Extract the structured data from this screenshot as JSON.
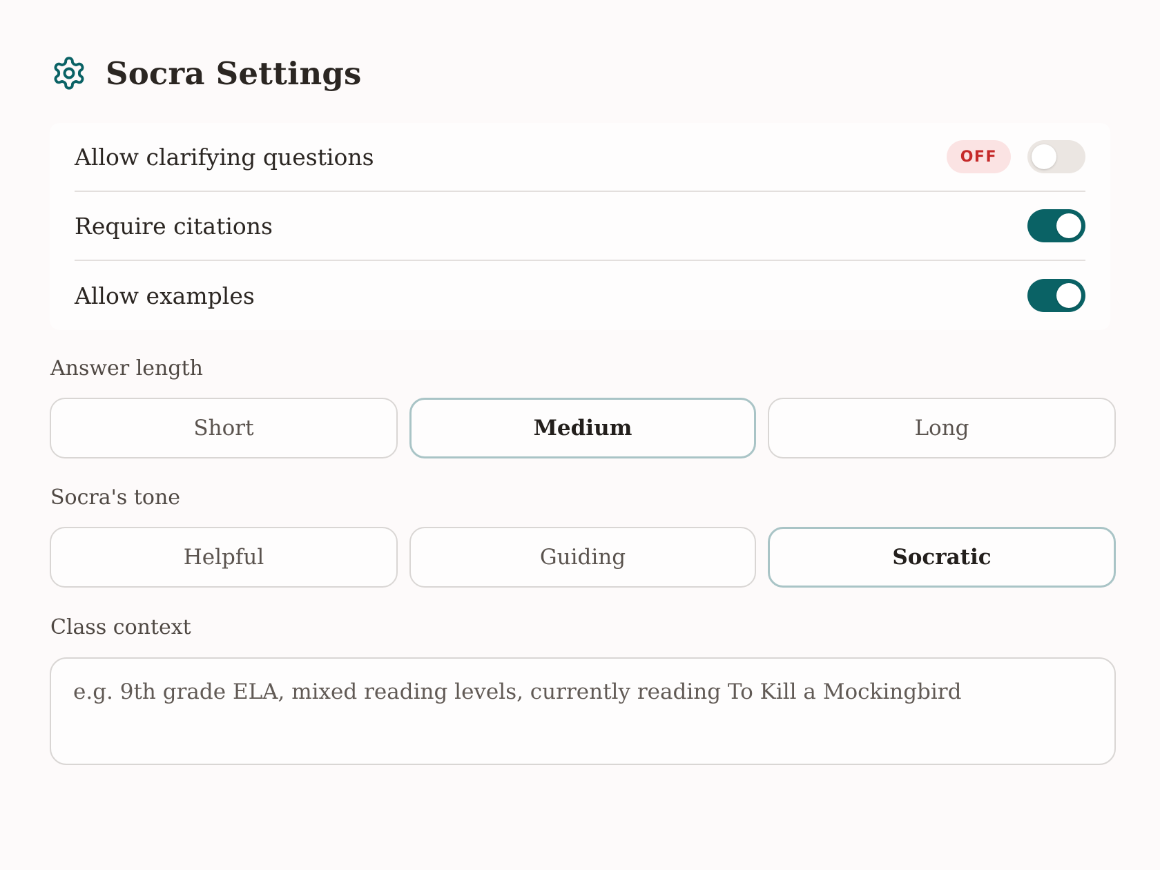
{
  "header": {
    "icon": "gear-icon",
    "title": "Socra Settings",
    "accent_color": "#0a6265"
  },
  "toggles": [
    {
      "label": "Allow clarifying questions",
      "state": "off",
      "badge": "OFF"
    },
    {
      "label": "Require citations",
      "state": "on"
    },
    {
      "label": "Allow examples",
      "state": "on"
    }
  ],
  "answer_length": {
    "label": "Answer length",
    "options": [
      "Short",
      "Medium",
      "Long"
    ],
    "selected": "Medium"
  },
  "tone": {
    "label": "Socra's tone",
    "options": [
      "Helpful",
      "Guiding",
      "Socratic"
    ],
    "selected": "Socratic"
  },
  "class_context": {
    "label": "Class context",
    "value": "",
    "placeholder": "e.g. 9th grade ELA, mixed reading levels, currently reading To Kill a Mockingbird"
  }
}
